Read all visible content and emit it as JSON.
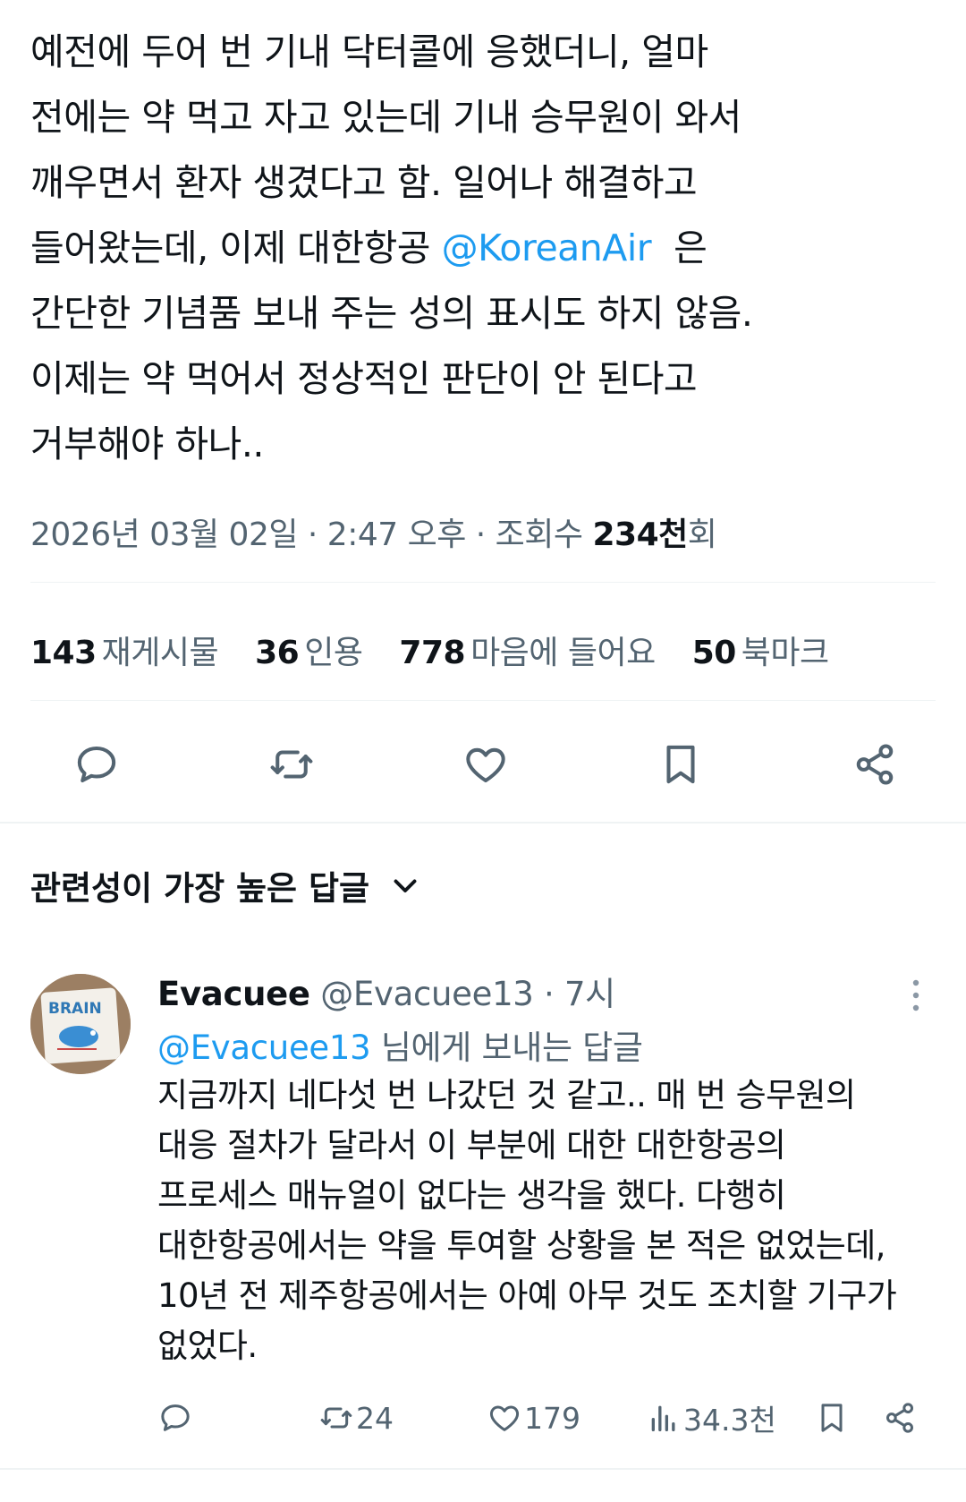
{
  "tweet": {
    "lines": [
      "예전에 두어 번 기내 닥터콜에 응했더니, 얼마",
      "전에는 약 먹고 자고 있는데 기내 승무원이 와서",
      "깨우면서 환자 생겼다고 함. 일어나 해결하고",
      "들어왔는데, 이제 대한항공 ",
      "간단한 기념품 보내 주는 성의 표시도 하지 않음.",
      "이제는 약 먹어서 정상적인 판단이 안 된다고",
      "거부해야 하나.."
    ],
    "mention": "@KoreanAir",
    "mention_suffix": "  은",
    "meta_prefix": "2026년 03월 02일 · 2:47 오후 · 조회수 ",
    "views": "234천",
    "views_suffix": "회"
  },
  "stats": [
    {
      "count": "143",
      "label": "재게시물"
    },
    {
      "count": "36",
      "label": "인용"
    },
    {
      "count": "778",
      "label": "마음에 들어요"
    },
    {
      "count": "50",
      "label": "북마크"
    }
  ],
  "actions": [
    "reply-icon",
    "retweet-icon",
    "heart-icon",
    "bookmark-icon",
    "share-icon"
  ],
  "sort": {
    "label": "관련성이 가장 높은 답글"
  },
  "reply": {
    "avatar_text": "BRAIN",
    "name": "Evacuee",
    "handle": "@Evacuee13",
    "time": " · 7시",
    "reply_to_mention": "@Evacuee13",
    "reply_to_suffix": " 님에게 보내는 답글",
    "lines": [
      "지금까지 네다섯 번 나갔던 것 같고.. 매 번 승무원의",
      "대응 절차가 달라서 이 부분에 대한 대한항공의",
      "프로세스 매뉴얼이 없다는 생각을 했다. 다행히",
      "대한항공에서는 약을 투여할 상황을 본 적은 없었는데,",
      "10년 전 제주항공에서는 아예 아무 것도 조치할 기구가",
      "없었다."
    ],
    "retweets": "24",
    "likes": "179",
    "views": "34.3천"
  },
  "colors": {
    "accent": "#1d9bf0",
    "secondary": "#536471",
    "text": "#0f1419",
    "divider": "#eff3f4"
  }
}
